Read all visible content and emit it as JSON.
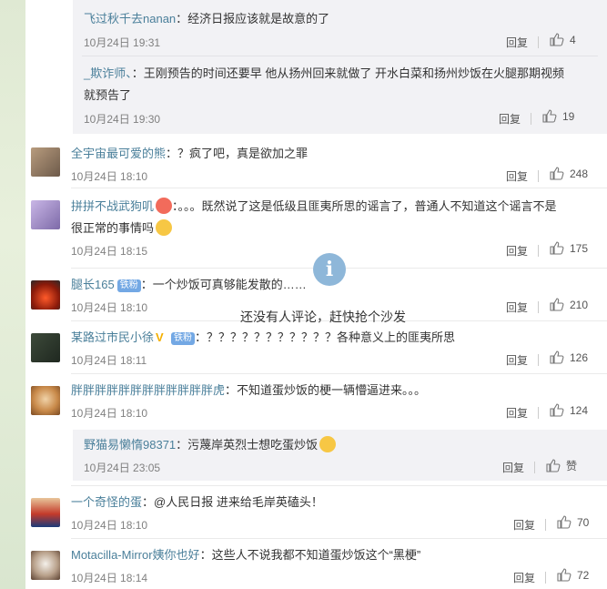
{
  "comments": [
    {
      "user": "全宇宙最可爱的熊",
      "text": "？疯了吧，真是欲加之罪",
      "time": "10月24日 18:10",
      "reply": "回复",
      "likes": "248"
    },
    {
      "user": "拼拼不战武狗叽",
      "text": "。。。既然说了这是低级且匪夷所思的谣言了，普通人不知道这个谣言不是",
      "text2": "很正常的事情吗",
      "time": "10月24日 18:15",
      "reply": "回复",
      "likes": "175"
    },
    {
      "user": "腿长165",
      "badge": "铁粉",
      "text": "一个炒饭可真够能发散的……",
      "time": "10月24日 18:10",
      "reply": "回复",
      "likes": "210"
    },
    {
      "user": "某路过市民小徐",
      "badge": "铁粉",
      "text": "？？？？？？？？？？？各种意义上的匪夷所思",
      "time": "10月24日 18:11",
      "reply": "回复",
      "likes": "126"
    },
    {
      "user": "胖胖胖胖胖胖胖胖胖胖胖胖虎",
      "text": "不知道蛋炒饭的梗一辆懵逼进来。。。",
      "time": "10月24日 18:10",
      "reply": "回复",
      "likes": "124"
    },
    {
      "user": "一个奇怪的蛋",
      "text": "@人民日报 进来给毛岸英磕头！",
      "time": "10月24日 18:10",
      "reply": "回复",
      "likes": "70"
    },
    {
      "user": "Motacilla-Mirror姨你也好",
      "text": "这些人不说我都不知道蛋炒饭这个“黑梗”",
      "time": "10月24日 18:14",
      "reply": "回复",
      "likes": "72"
    }
  ],
  "subreplies": [
    {
      "user": "飞过秋千去nanan",
      "text": "经济日报应该就是故意的了",
      "time": "10月24日 19:31",
      "reply": "回复",
      "likes": "4"
    },
    {
      "user": "_欺诈师、",
      "text": "王刚预告的时间还要早 他从扬州回来就做了 开水白菜和扬州炒饭在火腿那期视频",
      "text2": "就预告了",
      "time": "10月24日 19:30",
      "reply": "回复",
      "likes": "19"
    },
    {
      "user": "野猫易懒惰98371",
      "text": "污蔑岸英烈士想吃蛋炒饭",
      "time": "10月24日 23:05",
      "reply": "回复",
      "likes": "赞"
    }
  ],
  "overlay": {
    "icon": "i",
    "message": "还没有人评论，赶快抢个沙发"
  },
  "colors": {
    "username": "#4a7f9a",
    "badge": "#73a8e4",
    "time": "#808080"
  }
}
